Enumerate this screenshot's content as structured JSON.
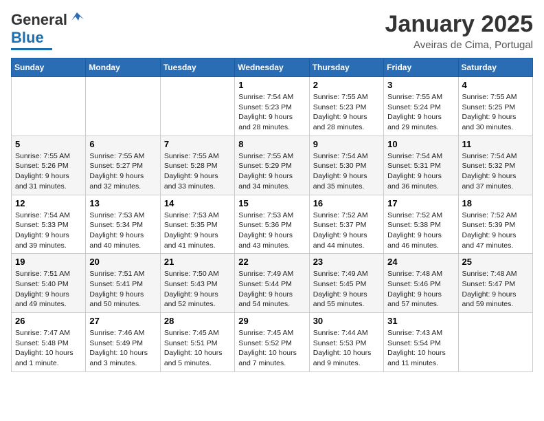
{
  "header": {
    "logo_general": "General",
    "logo_blue": "Blue",
    "month_title": "January 2025",
    "subtitle": "Aveiras de Cima, Portugal"
  },
  "weekdays": [
    "Sunday",
    "Monday",
    "Tuesday",
    "Wednesday",
    "Thursday",
    "Friday",
    "Saturday"
  ],
  "weeks": [
    [
      {
        "day": "",
        "info": ""
      },
      {
        "day": "",
        "info": ""
      },
      {
        "day": "",
        "info": ""
      },
      {
        "day": "1",
        "info": "Sunrise: 7:54 AM\nSunset: 5:23 PM\nDaylight: 9 hours\nand 28 minutes."
      },
      {
        "day": "2",
        "info": "Sunrise: 7:55 AM\nSunset: 5:23 PM\nDaylight: 9 hours\nand 28 minutes."
      },
      {
        "day": "3",
        "info": "Sunrise: 7:55 AM\nSunset: 5:24 PM\nDaylight: 9 hours\nand 29 minutes."
      },
      {
        "day": "4",
        "info": "Sunrise: 7:55 AM\nSunset: 5:25 PM\nDaylight: 9 hours\nand 30 minutes."
      }
    ],
    [
      {
        "day": "5",
        "info": "Sunrise: 7:55 AM\nSunset: 5:26 PM\nDaylight: 9 hours\nand 31 minutes."
      },
      {
        "day": "6",
        "info": "Sunrise: 7:55 AM\nSunset: 5:27 PM\nDaylight: 9 hours\nand 32 minutes."
      },
      {
        "day": "7",
        "info": "Sunrise: 7:55 AM\nSunset: 5:28 PM\nDaylight: 9 hours\nand 33 minutes."
      },
      {
        "day": "8",
        "info": "Sunrise: 7:55 AM\nSunset: 5:29 PM\nDaylight: 9 hours\nand 34 minutes."
      },
      {
        "day": "9",
        "info": "Sunrise: 7:54 AM\nSunset: 5:30 PM\nDaylight: 9 hours\nand 35 minutes."
      },
      {
        "day": "10",
        "info": "Sunrise: 7:54 AM\nSunset: 5:31 PM\nDaylight: 9 hours\nand 36 minutes."
      },
      {
        "day": "11",
        "info": "Sunrise: 7:54 AM\nSunset: 5:32 PM\nDaylight: 9 hours\nand 37 minutes."
      }
    ],
    [
      {
        "day": "12",
        "info": "Sunrise: 7:54 AM\nSunset: 5:33 PM\nDaylight: 9 hours\nand 39 minutes."
      },
      {
        "day": "13",
        "info": "Sunrise: 7:53 AM\nSunset: 5:34 PM\nDaylight: 9 hours\nand 40 minutes."
      },
      {
        "day": "14",
        "info": "Sunrise: 7:53 AM\nSunset: 5:35 PM\nDaylight: 9 hours\nand 41 minutes."
      },
      {
        "day": "15",
        "info": "Sunrise: 7:53 AM\nSunset: 5:36 PM\nDaylight: 9 hours\nand 43 minutes."
      },
      {
        "day": "16",
        "info": "Sunrise: 7:52 AM\nSunset: 5:37 PM\nDaylight: 9 hours\nand 44 minutes."
      },
      {
        "day": "17",
        "info": "Sunrise: 7:52 AM\nSunset: 5:38 PM\nDaylight: 9 hours\nand 46 minutes."
      },
      {
        "day": "18",
        "info": "Sunrise: 7:52 AM\nSunset: 5:39 PM\nDaylight: 9 hours\nand 47 minutes."
      }
    ],
    [
      {
        "day": "19",
        "info": "Sunrise: 7:51 AM\nSunset: 5:40 PM\nDaylight: 9 hours\nand 49 minutes."
      },
      {
        "day": "20",
        "info": "Sunrise: 7:51 AM\nSunset: 5:41 PM\nDaylight: 9 hours\nand 50 minutes."
      },
      {
        "day": "21",
        "info": "Sunrise: 7:50 AM\nSunset: 5:43 PM\nDaylight: 9 hours\nand 52 minutes."
      },
      {
        "day": "22",
        "info": "Sunrise: 7:49 AM\nSunset: 5:44 PM\nDaylight: 9 hours\nand 54 minutes."
      },
      {
        "day": "23",
        "info": "Sunrise: 7:49 AM\nSunset: 5:45 PM\nDaylight: 9 hours\nand 55 minutes."
      },
      {
        "day": "24",
        "info": "Sunrise: 7:48 AM\nSunset: 5:46 PM\nDaylight: 9 hours\nand 57 minutes."
      },
      {
        "day": "25",
        "info": "Sunrise: 7:48 AM\nSunset: 5:47 PM\nDaylight: 9 hours\nand 59 minutes."
      }
    ],
    [
      {
        "day": "26",
        "info": "Sunrise: 7:47 AM\nSunset: 5:48 PM\nDaylight: 10 hours\nand 1 minute."
      },
      {
        "day": "27",
        "info": "Sunrise: 7:46 AM\nSunset: 5:49 PM\nDaylight: 10 hours\nand 3 minutes."
      },
      {
        "day": "28",
        "info": "Sunrise: 7:45 AM\nSunset: 5:51 PM\nDaylight: 10 hours\nand 5 minutes."
      },
      {
        "day": "29",
        "info": "Sunrise: 7:45 AM\nSunset: 5:52 PM\nDaylight: 10 hours\nand 7 minutes."
      },
      {
        "day": "30",
        "info": "Sunrise: 7:44 AM\nSunset: 5:53 PM\nDaylight: 10 hours\nand 9 minutes."
      },
      {
        "day": "31",
        "info": "Sunrise: 7:43 AM\nSunset: 5:54 PM\nDaylight: 10 hours\nand 11 minutes."
      },
      {
        "day": "",
        "info": ""
      }
    ]
  ]
}
